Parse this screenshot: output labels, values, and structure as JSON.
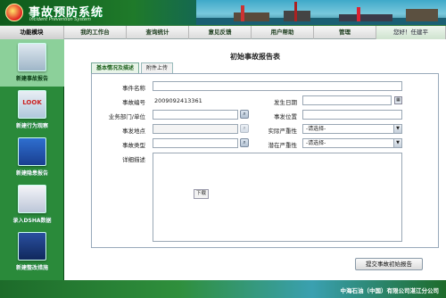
{
  "app": {
    "title_cn": "事故预防系统",
    "title_en": "Incident Prevention System"
  },
  "nav": {
    "func_module": "功能模块",
    "tabs": [
      "我的工作台",
      "查询统计",
      "意见反馈",
      "用户帮助",
      "管理"
    ],
    "user_greeting": "您好！任建平"
  },
  "sidebar": {
    "items": [
      {
        "label": "新建事故报告",
        "icon": "report-icon",
        "active": true
      },
      {
        "label": "新建行为观察",
        "icon": "look-icon",
        "active": false
      },
      {
        "label": "新建隐患报告",
        "icon": "hazard-icon",
        "active": false
      },
      {
        "label": "录入DSHA数据",
        "icon": "data-chart-icon",
        "active": false
      },
      {
        "label": "新建整改措施",
        "icon": "wrench-icon",
        "active": false
      }
    ]
  },
  "form": {
    "title": "初始事故报告表",
    "tabs": [
      "基本情况及描述",
      "附件上传"
    ],
    "active_tab": 0,
    "fields": {
      "event_name_label": "事件名称",
      "event_name_value": "",
      "event_no_label": "事故编号",
      "event_no_value": "2009092413361",
      "date_label": "发生日期",
      "date_value": "",
      "dept_label": "业务部门/单位",
      "dept_value": "",
      "location_label": "事发位置",
      "location_value": "",
      "place_label": "事发地点",
      "place_value": "",
      "actual_severity_label": "实际严重性",
      "actual_severity_value": "-请选择-",
      "event_type_label": "事故类型",
      "event_type_value": "",
      "potential_severity_label": "潜在严重性",
      "potential_severity_value": "-请选择-",
      "desc_label": "详细描述",
      "desc_value": ""
    },
    "download_label": "下载",
    "submit_label": "提交事故初始报告"
  },
  "footer": {
    "copyright": "中海石油（中国）有限公司湛江分公司"
  },
  "colors": {
    "brand_green": "#2a8a3a",
    "active_tab_green": "#1a5f1a"
  }
}
